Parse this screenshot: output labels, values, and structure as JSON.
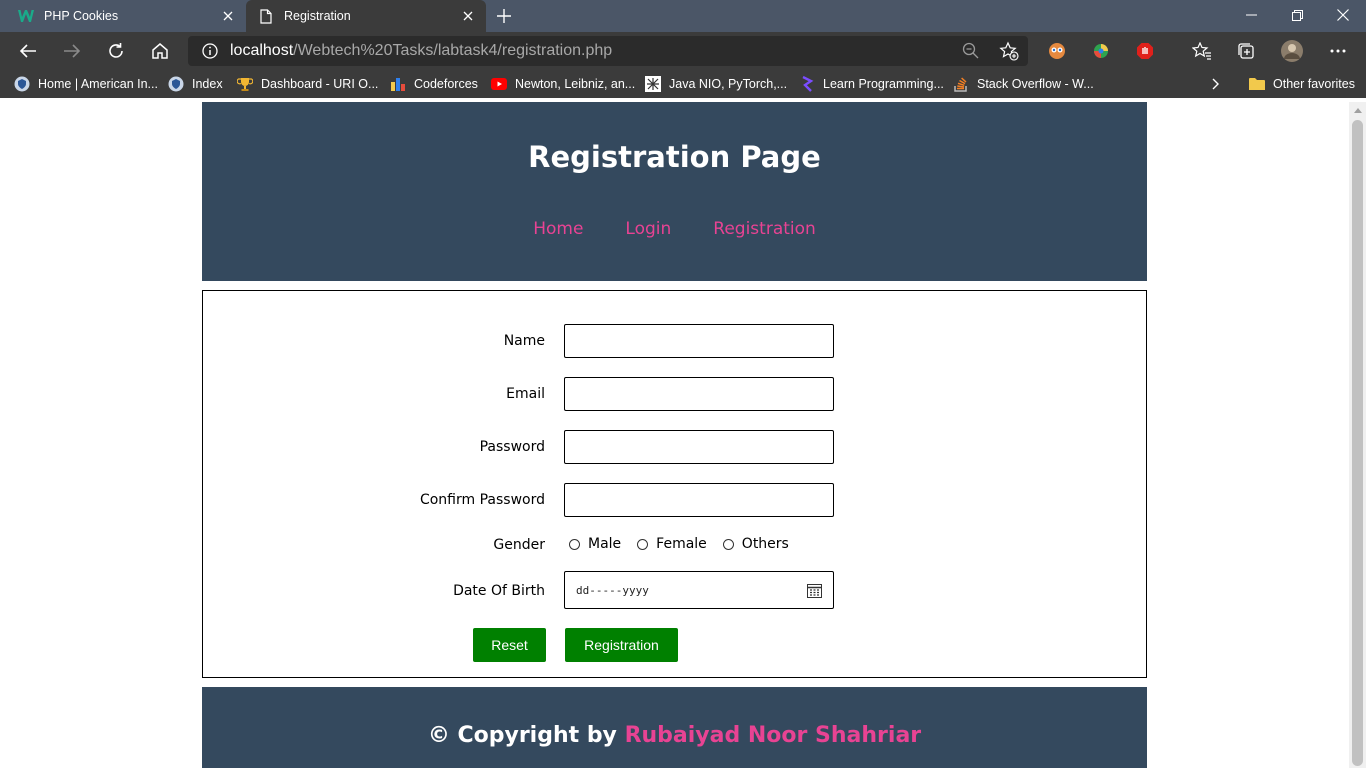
{
  "browser": {
    "tabs": [
      {
        "title": "PHP Cookies",
        "active": false
      },
      {
        "title": "Registration",
        "active": true
      }
    ],
    "url": {
      "host": "localhost",
      "path": "/Webtech%20Tasks/labtask4/registration.php"
    },
    "bookmarks": [
      {
        "label": "Home | American In...",
        "icon": "shield-icon"
      },
      {
        "label": "Index",
        "icon": "shield-icon"
      },
      {
        "label": "Dashboard - URI O...",
        "icon": "trophy-icon"
      },
      {
        "label": "Codeforces",
        "icon": "bar-chart-icon"
      },
      {
        "label": "Newton, Leibniz, an...",
        "icon": "youtube-icon"
      },
      {
        "label": "Java NIO, PyTorch,...",
        "icon": "geeks-icon"
      },
      {
        "label": "Learn Programming...",
        "icon": "code-icon"
      },
      {
        "label": "Stack Overflow - W...",
        "icon": "stackoverflow-icon"
      }
    ],
    "other_favorites": "Other favorites"
  },
  "page": {
    "title": "Registration Page",
    "nav": [
      "Home",
      "Login",
      "Registration"
    ],
    "form": {
      "name_label": "Name",
      "email_label": "Email",
      "password_label": "Password",
      "confirm_password_label": "Confirm Password",
      "gender_label": "Gender",
      "gender_options": [
        "Male",
        "Female",
        "Others"
      ],
      "dob_label": "Date Of Birth",
      "dob_placeholder": "dd-----yyyy",
      "reset_label": "Reset",
      "submit_label": "Registration"
    },
    "footer": {
      "prefix": "© Copyright by ",
      "author": "Rubaiyad Noor Shahriar"
    }
  },
  "colors": {
    "header_bg": "#34495e",
    "link": "#e84393",
    "button": "#008000"
  }
}
